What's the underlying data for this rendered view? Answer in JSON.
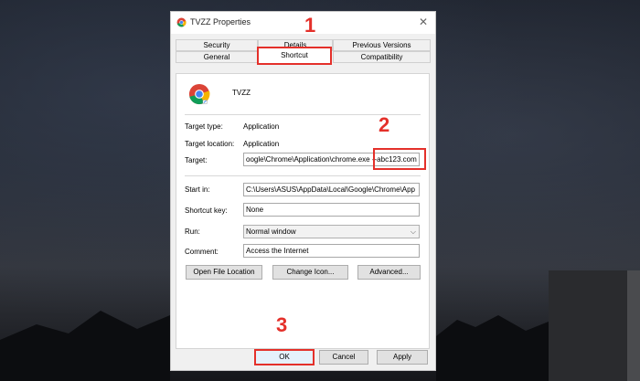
{
  "window": {
    "title": "TVZZ Properties",
    "close_glyph": "✕"
  },
  "tabs": {
    "security": "Security",
    "details": "Details",
    "previous_versions": "Previous Versions",
    "general": "General",
    "shortcut": "Shortcut",
    "compatibility": "Compatibility"
  },
  "shortcut": {
    "name": "TVZZ",
    "target_type_label": "Target type:",
    "target_type_value": "Application",
    "target_location_label": "Target location:",
    "target_location_value": "Application",
    "target_label": "Target:",
    "target_value": "oogle\\Chrome\\Application\\chrome.exe --abc123.com",
    "start_in_label": "Start in:",
    "start_in_value": "C:\\Users\\ASUS\\AppData\\Local\\Google\\Chrome\\App",
    "shortcut_key_label": "Shortcut key:",
    "shortcut_key_value": "None",
    "run_label": "Run:",
    "run_value": "Normal window",
    "comment_label": "Comment:",
    "comment_value": "Access the Internet",
    "open_file_location": "Open File Location",
    "change_icon": "Change Icon...",
    "advanced": "Advanced..."
  },
  "footer": {
    "ok": "OK",
    "cancel": "Cancel",
    "apply": "Apply"
  },
  "annotations": {
    "step1": "1",
    "step2": "2",
    "step3": "3"
  },
  "colors": {
    "highlight": "#e4302a",
    "dialog_bg": "#f0f0f0"
  },
  "icons": {
    "app": "chrome-icon",
    "dropdown": "chevron-down-icon"
  }
}
